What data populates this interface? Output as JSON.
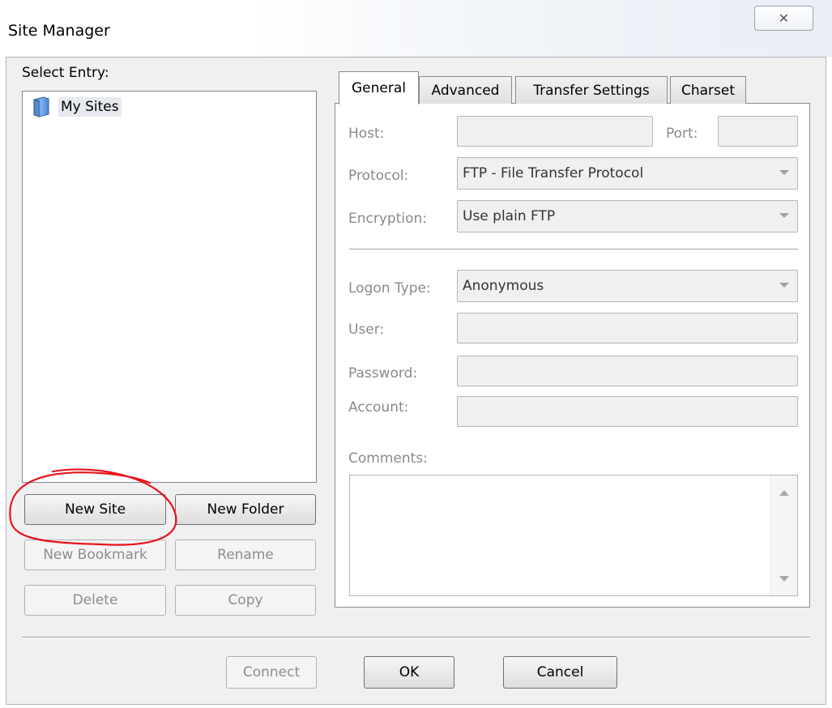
{
  "window": {
    "title": "Site Manager",
    "close_glyph": "✕"
  },
  "left": {
    "select_entry_label": "Select Entry:",
    "tree": [
      {
        "label": "My Sites",
        "icon": "folder-icon"
      }
    ],
    "buttons": {
      "new_site": "New Site",
      "new_folder": "New Folder",
      "new_bookmark": "New Bookmark",
      "rename": "Rename",
      "delete": "Delete",
      "copy": "Copy"
    }
  },
  "tabs": [
    {
      "label": "General",
      "active": true
    },
    {
      "label": "Advanced",
      "active": false
    },
    {
      "label": "Transfer Settings",
      "active": false
    },
    {
      "label": "Charset",
      "active": false
    }
  ],
  "general": {
    "host_label": "Host:",
    "host_value": "",
    "port_label": "Port:",
    "port_value": "",
    "protocol_label": "Protocol:",
    "protocol_value": "FTP - File Transfer Protocol",
    "encryption_label": "Encryption:",
    "encryption_value": "Use plain FTP",
    "logon_type_label": "Logon Type:",
    "logon_type_value": "Anonymous",
    "user_label": "User:",
    "user_value": "",
    "password_label": "Password:",
    "password_value": "",
    "account_label": "Account:",
    "account_value": "",
    "comments_label": "Comments:",
    "comments_value": ""
  },
  "footer": {
    "connect": "Connect",
    "ok": "OK",
    "cancel": "Cancel"
  },
  "colors": {
    "annotation": "#e8141c",
    "disabled_text": "#8a8a8a",
    "dialog_bg": "#f0f0f0"
  }
}
